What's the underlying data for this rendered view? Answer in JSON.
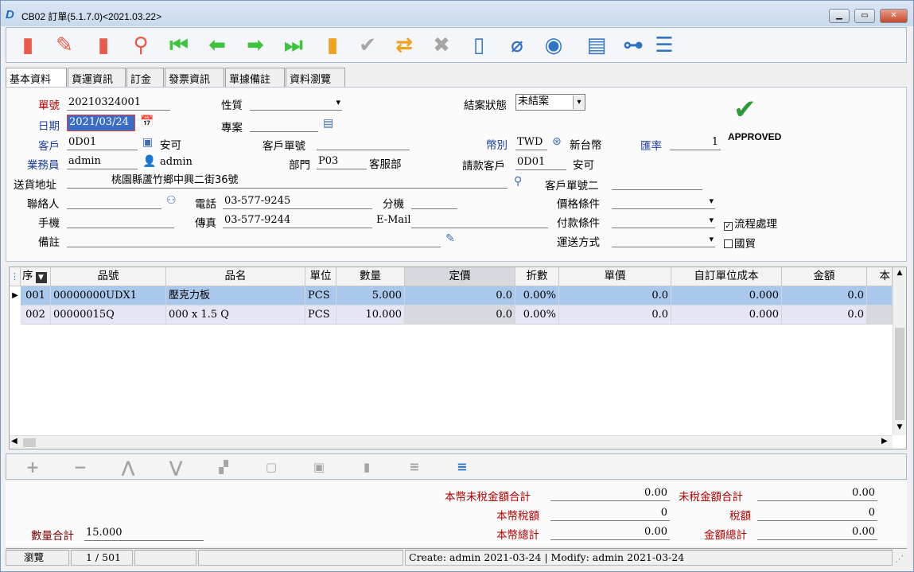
{
  "window": {
    "title": "CB02 訂單(5.1.7.0)<2021.03.22>",
    "logo": "D"
  },
  "toolbar": {
    "icons": [
      "new-doc-icon",
      "edit-icon",
      "delete-icon",
      "search-icon",
      "first-record-icon",
      "prev-record-icon",
      "next-record-icon",
      "last-record-icon",
      "copy-icon",
      "confirm-icon",
      "transfer-icon",
      "cancel-icon",
      "book-icon",
      "attach-icon",
      "view-icon",
      "excel-icon",
      "tree-icon",
      "menu-icon"
    ]
  },
  "tabs": [
    "基本資料",
    "貨運資訊",
    "訂金",
    "發票資訊",
    "單據備註",
    "資料瀏覽"
  ],
  "form": {
    "order_no_label": "單號",
    "order_no": "20210324001",
    "property_label": "性質",
    "property": "",
    "close_status_label": "結案狀態",
    "close_status": "未結案",
    "date_label": "日期",
    "date": "2021/03/24",
    "project_label": "專案",
    "project": "",
    "customer_label": "客戶",
    "customer_code": "0D01",
    "customer_name": "安可",
    "cust_order_label": "客戶單號",
    "cust_order": "",
    "currency_label": "幣別",
    "currency": "TWD",
    "currency_name": "新台幣",
    "rate_label": "匯率",
    "rate": "1",
    "sales_label": "業務員",
    "sales": "admin",
    "sales_name": "admin",
    "dept_label": "部門",
    "dept": "P03",
    "dept_name": "客服部",
    "bill_cust_label": "請款客戶",
    "bill_cust": "0D01",
    "bill_cust_name": "安可",
    "address_label": "送貨地址",
    "address": "桃園縣蘆竹鄉中興二街36號",
    "cust_order2_label": "客戶單號二",
    "cust_order2": "",
    "contact_label": "聯絡人",
    "contact": "",
    "phone_label": "電話",
    "phone": "03-577-9245",
    "ext_label": "分機",
    "ext": "",
    "price_cond_label": "價格條件",
    "price_cond": "",
    "mobile_label": "手機",
    "mobile": "",
    "fax_label": "傳真",
    "fax": "03-577-9244",
    "email_label": "E-Mail",
    "email": "",
    "pay_cond_label": "付款條件",
    "pay_cond": "",
    "workflow_label": "流程處理",
    "workflow_checked": true,
    "remark_label": "備註",
    "remark": "",
    "ship_label": "運送方式",
    "ship": "",
    "intl_label": "國貿",
    "intl_checked": false,
    "approved_text": "APPROVED"
  },
  "grid": {
    "headers": [
      "序",
      "品號",
      "品名",
      "單位",
      "數量",
      "定價",
      "折數",
      "單價",
      "自訂單位成本",
      "金額",
      "本"
    ],
    "rows": [
      [
        "001",
        "00000000UDX1",
        "壓克力板",
        "PCS",
        "5.000",
        "0.0",
        "0.00%",
        "0.0",
        "0.000",
        "0.0",
        ""
      ],
      [
        "002",
        "00000015Q",
        "000 x 1.5 Q",
        "PCS",
        "10.000",
        "0.0",
        "0.00%",
        "0.0",
        "0.000",
        "0.0",
        ""
      ]
    ]
  },
  "nav": {
    "icons": [
      "add-row-icon",
      "remove-row-icon",
      "move-up-icon",
      "move-down-icon",
      "stack-icon",
      "paste-icon",
      "save-icon",
      "doc-icon",
      "list-icon",
      "list-active-icon"
    ]
  },
  "totals": {
    "local_untaxed_label": "本幣未稅金額合計",
    "local_untaxed": "0.00",
    "untaxed_label": "未稅金額合計",
    "untaxed": "0.00",
    "local_tax_label": "本幣稅額",
    "local_tax": "0",
    "tax_label": "稅額",
    "tax": "0",
    "local_total_label": "本幣總計",
    "local_total": "0.00",
    "total_label": "金額總計",
    "total": "0.00",
    "qty_label": "數量合計",
    "qty": "15.000"
  },
  "status": {
    "mode": "瀏覽",
    "page": "1 / 501",
    "info": "Create: admin 2021-03-24 | Modify: admin 2021-03-24"
  }
}
